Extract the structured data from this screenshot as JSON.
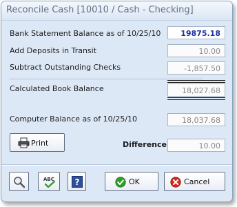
{
  "window": {
    "title": "Reconcile Cash [10010 / Cash - Checking]"
  },
  "form": {
    "bank_statement_label": "Bank Statement Balance as of 10/25/10",
    "bank_statement_value": "19875.18",
    "deposits_label": "Add Deposits in Transit",
    "deposits_value": "10.00",
    "checks_label": "Subtract Outstanding Checks",
    "checks_value": "-1,857.50",
    "book_balance_label": "Calculated Book Balance",
    "book_balance_value": "18,027.68",
    "computer_balance_label": "Computer Balance as of 10/25/10",
    "computer_balance_value": "18,037.68",
    "difference_label": "Difference",
    "difference_value": "10.00"
  },
  "buttons": {
    "print_label": "Print",
    "ok_label": "OK",
    "cancel_label": "Cancel"
  },
  "icons": {
    "print": "printer-icon",
    "search": "magnifier-icon",
    "spellcheck": "spellcheck-icon",
    "help": "help-icon",
    "ok": "green-check-icon",
    "cancel": "red-x-icon"
  },
  "colors": {
    "window_bg": "#dde8f6",
    "editable_value": "#1d2fa5",
    "ok_green": "#2e9d2a",
    "cancel_red": "#d32a1e"
  }
}
